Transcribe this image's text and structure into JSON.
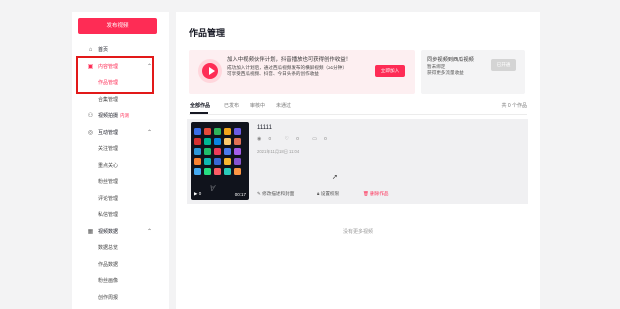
{
  "sidebar": {
    "publish_label": "发布视频",
    "items": [
      {
        "label": "首页",
        "icon": "home-icon",
        "glyph": "⌂",
        "chevron": ""
      },
      {
        "label": "内容管理",
        "icon": "content-icon",
        "glyph": "▣",
        "chevron": "^"
      },
      {
        "label": "作品管理",
        "sub": true
      },
      {
        "label": "合集管理",
        "sub": true
      },
      {
        "label": "视频拍摄",
        "icon": "camera-icon",
        "glyph": "⚇",
        "badge": "内测",
        "chevron": ""
      },
      {
        "label": "互动管理",
        "icon": "interact-icon",
        "glyph": "◎",
        "chevron": "^"
      },
      {
        "label": "关注管理",
        "sub": true
      },
      {
        "label": "重点关心",
        "sub": true
      },
      {
        "label": "粉丝管理",
        "sub": true
      },
      {
        "label": "评论管理",
        "sub": true
      },
      {
        "label": "私信管理",
        "sub": true
      },
      {
        "label": "视频数据",
        "icon": "data-icon",
        "glyph": "▦",
        "chevron": "^"
      },
      {
        "label": "数据总览",
        "sub": true
      },
      {
        "label": "作品数据",
        "sub": true
      },
      {
        "label": "粉丝画像",
        "sub": true
      },
      {
        "label": "创作周报",
        "sub": true
      }
    ]
  },
  "main": {
    "title": "作品管理",
    "promo": {
      "line1": "加入中视频伙伴计划，抖音播放也可获得创作收益！",
      "line2": "成功加入计划后，通过西瓜视频发布的横屏视频（≥1分钟）",
      "line3": "可享受西瓜视频、抖音、今日头条的创作收益",
      "button": "立即加入"
    },
    "sync": {
      "line1": "同步视频到西瓜视频",
      "line2": "暂未绑定",
      "line3": "获得更多流量收益",
      "button": "已开通"
    },
    "tabs": [
      "全部作品",
      "已发布",
      "审核中",
      "未通过"
    ],
    "total": "共 0 个作品",
    "video": {
      "title": "11111",
      "plays": "0",
      "likes": "0",
      "comments": "0",
      "date": "2021年11月18日 11:04",
      "duration": "00:17",
      "play_count": "0",
      "actions": [
        "修改描述和封面",
        "设置权限",
        "删除作品"
      ]
    },
    "no_more": "没有更多视频"
  },
  "colors": {
    "accent": "#fe2c55",
    "highlight_box": "#e21919"
  }
}
